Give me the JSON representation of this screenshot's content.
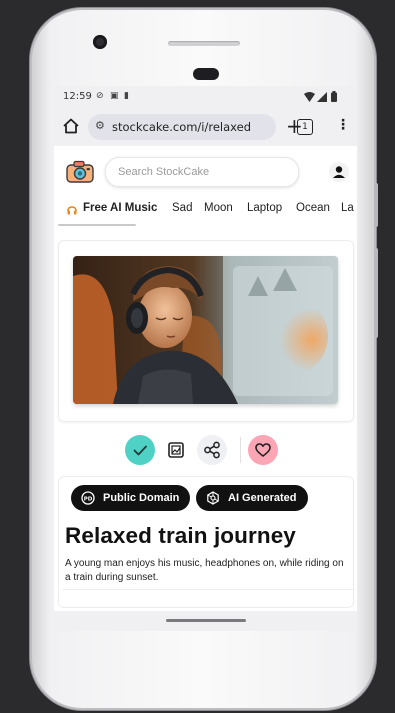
{
  "status": {
    "time": "12:59",
    "icons": [
      "dnd-icon",
      "notification-icon",
      "clipboard-icon",
      "wifi-icon",
      "signal-icon",
      "battery-icon"
    ]
  },
  "browser": {
    "url": "stockcake.com/i/relaxed",
    "tab_count": "1"
  },
  "site": {
    "search_placeholder": "Search StockCake"
  },
  "categories": [
    {
      "label": "Free AI Music",
      "active": true
    },
    {
      "label": "Sad"
    },
    {
      "label": "Moon"
    },
    {
      "label": "Laptop"
    },
    {
      "label": "Ocean"
    },
    {
      "label": "La"
    }
  ],
  "badges": {
    "public_domain": "Public Domain",
    "ai_generated": "AI Generated"
  },
  "detail": {
    "title": "Relaxed train journey",
    "description": "A young man enjoys his music, headphones on, while riding on a train during sunset."
  },
  "colors": {
    "check_button": "#4fd1c5",
    "like_button": "#fca5b5",
    "badge_bg": "#111111"
  }
}
